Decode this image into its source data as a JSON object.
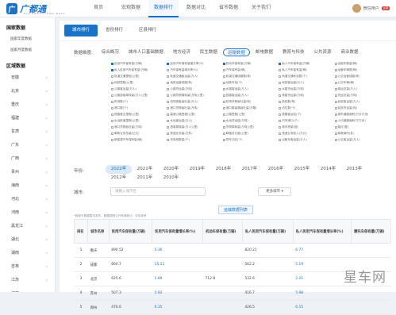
{
  "header": {
    "logo": "广都通",
    "logo_sub": "GUANGDOUTONG DATA",
    "nav": [
      "首页",
      "宏观数据",
      "数据排行",
      "数据对比",
      "省市数据",
      "关于我们"
    ],
    "active_nav": 2,
    "user": "微信用户",
    "vip": "VIP"
  },
  "sidebar": {
    "national": "国家数据",
    "national_items": [
      "国家年度数据",
      "国家月度数据"
    ],
    "regional": "区域数据",
    "provinces": [
      "安徽",
      "北京",
      "重庆",
      "福建",
      "甘肃",
      "广东",
      "广西",
      "贵州",
      "海南",
      "河北",
      "河南",
      "黑龙江",
      "湖北",
      "湖南",
      "吉林",
      "江苏",
      "江西"
    ]
  },
  "tabs": [
    "城市排行",
    "省份排行",
    "区县排行"
  ],
  "dimension_label": "数据维度:",
  "categories": [
    "综合概况",
    "城市人口基础数据",
    "地方经济",
    "民生数据",
    "运输数据",
    "邮电数据",
    "教育与科技",
    "公共资源",
    "商业数据"
  ],
  "active_category": 4,
  "options": [
    {
      "t": "民用汽车保有量(万辆)",
      "on": true
    },
    {
      "t": "民用汽车保有量增长率(%)",
      "on": true
    },
    {
      "t": "机动车保有量(万辆)",
      "on": true
    },
    {
      "t": "私人汽车保有量(万辆)",
      "on": true
    },
    {
      "t": "出租车数量(辆)",
      "on": false
    },
    {
      "t": "私人民用汽车保有量(万辆)",
      "on": true
    },
    {
      "t": "汽车保有量增长率(%)",
      "on": false
    },
    {
      "t": "汽车保有量(辆)",
      "on": false
    },
    {
      "t": "私人汽车保有量(辆)",
      "on": false
    },
    {
      "t": "运营车辆数(辆)",
      "on": false
    },
    {
      "t": "轨道交通里程(公里)",
      "on": false
    },
    {
      "t": "轨道交通客运量(万人)",
      "on": false
    },
    {
      "t": "轨道交通线路数(条)",
      "on": false
    },
    {
      "t": "轨道交通车站数(个)",
      "on": false
    },
    {
      "t": "公交运营线路(条)",
      "on": false
    },
    {
      "t": "地铁里程(公里)",
      "on": false
    },
    {
      "t": "地铁运营线路(条)",
      "on": false
    },
    {
      "t": "地铁车站(个)",
      "on": false
    },
    {
      "t": "地铁客运量(万人)",
      "on": false
    },
    {
      "t": "公交车辆(辆)",
      "on": false
    },
    {
      "t": "公路客运量(万人)",
      "on": false
    },
    {
      "t": "公路货运量(万吨)",
      "on": false
    },
    {
      "t": "水路客运量(万人)",
      "on": false
    },
    {
      "t": "水路货运量(万吨)",
      "on": false
    },
    {
      "t": "客运总量(万人)",
      "on": false
    },
    {
      "t": "公路旅客周转量(万人公里)",
      "on": false
    },
    {
      "t": "公路货物周转量(万吨公里)",
      "on": false
    },
    {
      "t": "铁路客运量(万人)",
      "on": false
    },
    {
      "t": "铁路货运量(万吨)",
      "on": false
    },
    {
      "t": "货运总量(万吨)",
      "on": false
    },
    {
      "t": "机场数(个)",
      "on": false
    },
    {
      "t": "机场旅客吞吐量(万人)",
      "on": false
    },
    {
      "t": "机场货邮吞吐量(吨)",
      "on": false
    },
    {
      "t": "航线数(条)",
      "on": false
    },
    {
      "t": "民航客运量(万人)",
      "on": false
    },
    {
      "t": "港口数(个)",
      "on": false
    },
    {
      "t": "港口货物吞吐量(万吨)",
      "on": false
    },
    {
      "t": "港口集装箱吞吐量(万箱)",
      "on": false
    },
    {
      "t": "泊位数(个)",
      "on": false
    },
    {
      "t": "民航货运量(吨)",
      "on": false
    },
    {
      "t": "铁路营业里程(公里)",
      "on": false
    },
    {
      "t": "高速公路里程(公里)",
      "on": false
    },
    {
      "t": "公路里程(公里)",
      "on": false
    },
    {
      "t": "铁路客运站(个)",
      "on": false
    },
    {
      "t": "城市道路面积(万平方米)",
      "on": false
    },
    {
      "t": "水运航道里程(公里)",
      "on": false
    },
    {
      "t": "水运客运量(万人)",
      "on": false
    },
    {
      "t": "水运货运量(万吨)",
      "on": false
    },
    {
      "t": "内河港口(个)",
      "on": false
    },
    {
      "t": "人均道路面积(平方米)",
      "on": false
    },
    {
      "t": "港口货物吞吐量(万吨)",
      "on": false
    },
    {
      "t": "旅客周转量(万人公里)",
      "on": false
    },
    {
      "t": "货物周转量(万吨公里)",
      "on": false
    },
    {
      "t": "城市桥梁(座)",
      "on": false
    },
    {
      "t": "路灯(盏)",
      "on": false
    },
    {
      "t": "邮政业务总量(亿元)",
      "on": false
    },
    {
      "t": "快递业务量(万件)",
      "on": false
    },
    {
      "t": "邮路总长度(公里)",
      "on": false
    },
    {
      "t": "快递业务收入(万元)",
      "on": false
    },
    {
      "t": "邮政局所(处)",
      "on": false
    },
    {
      "t": "新能源汽车保有量(辆)",
      "on": false
    },
    {
      "t": "充电桩数量(个)",
      "on": false
    },
    {
      "t": "停车泊位(个)",
      "on": false
    },
    {
      "t": "出租车客运量(万人)",
      "on": false
    },
    {
      "t": "公交客运量(万人)",
      "on": false
    }
  ],
  "year_label": "年份:",
  "years": [
    "2022年",
    "2021年",
    "2020年",
    "2019年",
    "2018年",
    "2017年",
    "2016年",
    "2015年",
    "2014年",
    "2013年",
    "2012年",
    "2011年",
    "2010年"
  ],
  "active_year": 0,
  "city_label": "城市:",
  "city_placeholder": "请输入城市名",
  "more_cities": "更多城市 ▾",
  "table_title": "运输数据列表",
  "note": "*因部分数据暂未发布，数据按照公开来源统计，仅供参考",
  "columns": [
    "排名",
    "城市名称",
    "民用汽车保有量(万辆)",
    "民用汽车保有量增长率(%)",
    "机动车保有量(万辆)",
    "私人民用汽车保有量(万辆)",
    "私人民用汽车保有量增长率(%)",
    "摩托车保有量(万辆)"
  ],
  "rows": [
    [
      "1",
      "重庆",
      "890.52",
      "5.36",
      "",
      "820.21",
      "6.77",
      ""
    ],
    [
      "2",
      "成都",
      "660.7",
      "15.11",
      "",
      "562.2",
      "5.19",
      ""
    ],
    [
      "3",
      "北京",
      "625.6",
      "1.89",
      "712.8",
      "532.6",
      "2.21",
      ""
    ],
    [
      "4",
      "苏州",
      "507.3",
      "5.92",
      "",
      "416.7",
      "5.98",
      ""
    ],
    [
      "5",
      "郑州",
      "470.6",
      "6.35",
      "",
      "426.5",
      "6.15",
      ""
    ]
  ],
  "watermark": "星车网"
}
